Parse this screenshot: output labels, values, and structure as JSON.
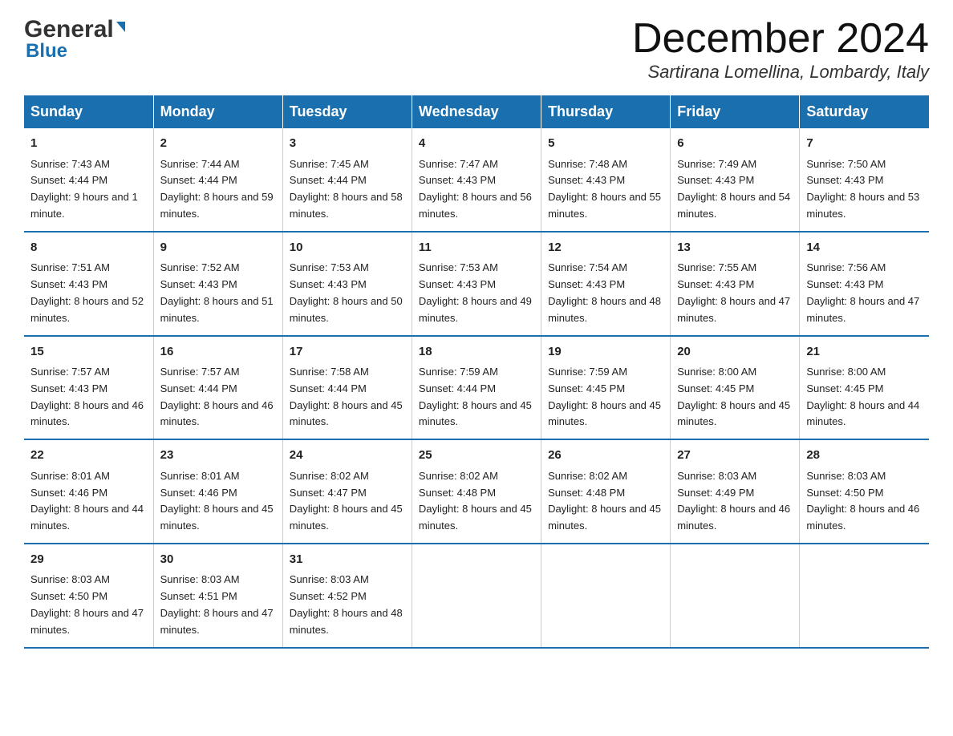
{
  "header": {
    "logo_general": "General",
    "logo_blue": "Blue",
    "month_title": "December 2024",
    "location": "Sartirana Lomellina, Lombardy, Italy"
  },
  "days_of_week": [
    "Sunday",
    "Monday",
    "Tuesday",
    "Wednesday",
    "Thursday",
    "Friday",
    "Saturday"
  ],
  "weeks": [
    [
      {
        "day": "1",
        "sunrise": "7:43 AM",
        "sunset": "4:44 PM",
        "daylight": "9 hours and 1 minute."
      },
      {
        "day": "2",
        "sunrise": "7:44 AM",
        "sunset": "4:44 PM",
        "daylight": "8 hours and 59 minutes."
      },
      {
        "day": "3",
        "sunrise": "7:45 AM",
        "sunset": "4:44 PM",
        "daylight": "8 hours and 58 minutes."
      },
      {
        "day": "4",
        "sunrise": "7:47 AM",
        "sunset": "4:43 PM",
        "daylight": "8 hours and 56 minutes."
      },
      {
        "day": "5",
        "sunrise": "7:48 AM",
        "sunset": "4:43 PM",
        "daylight": "8 hours and 55 minutes."
      },
      {
        "day": "6",
        "sunrise": "7:49 AM",
        "sunset": "4:43 PM",
        "daylight": "8 hours and 54 minutes."
      },
      {
        "day": "7",
        "sunrise": "7:50 AM",
        "sunset": "4:43 PM",
        "daylight": "8 hours and 53 minutes."
      }
    ],
    [
      {
        "day": "8",
        "sunrise": "7:51 AM",
        "sunset": "4:43 PM",
        "daylight": "8 hours and 52 minutes."
      },
      {
        "day": "9",
        "sunrise": "7:52 AM",
        "sunset": "4:43 PM",
        "daylight": "8 hours and 51 minutes."
      },
      {
        "day": "10",
        "sunrise": "7:53 AM",
        "sunset": "4:43 PM",
        "daylight": "8 hours and 50 minutes."
      },
      {
        "day": "11",
        "sunrise": "7:53 AM",
        "sunset": "4:43 PM",
        "daylight": "8 hours and 49 minutes."
      },
      {
        "day": "12",
        "sunrise": "7:54 AM",
        "sunset": "4:43 PM",
        "daylight": "8 hours and 48 minutes."
      },
      {
        "day": "13",
        "sunrise": "7:55 AM",
        "sunset": "4:43 PM",
        "daylight": "8 hours and 47 minutes."
      },
      {
        "day": "14",
        "sunrise": "7:56 AM",
        "sunset": "4:43 PM",
        "daylight": "8 hours and 47 minutes."
      }
    ],
    [
      {
        "day": "15",
        "sunrise": "7:57 AM",
        "sunset": "4:43 PM",
        "daylight": "8 hours and 46 minutes."
      },
      {
        "day": "16",
        "sunrise": "7:57 AM",
        "sunset": "4:44 PM",
        "daylight": "8 hours and 46 minutes."
      },
      {
        "day": "17",
        "sunrise": "7:58 AM",
        "sunset": "4:44 PM",
        "daylight": "8 hours and 45 minutes."
      },
      {
        "day": "18",
        "sunrise": "7:59 AM",
        "sunset": "4:44 PM",
        "daylight": "8 hours and 45 minutes."
      },
      {
        "day": "19",
        "sunrise": "7:59 AM",
        "sunset": "4:45 PM",
        "daylight": "8 hours and 45 minutes."
      },
      {
        "day": "20",
        "sunrise": "8:00 AM",
        "sunset": "4:45 PM",
        "daylight": "8 hours and 45 minutes."
      },
      {
        "day": "21",
        "sunrise": "8:00 AM",
        "sunset": "4:45 PM",
        "daylight": "8 hours and 44 minutes."
      }
    ],
    [
      {
        "day": "22",
        "sunrise": "8:01 AM",
        "sunset": "4:46 PM",
        "daylight": "8 hours and 44 minutes."
      },
      {
        "day": "23",
        "sunrise": "8:01 AM",
        "sunset": "4:46 PM",
        "daylight": "8 hours and 45 minutes."
      },
      {
        "day": "24",
        "sunrise": "8:02 AM",
        "sunset": "4:47 PM",
        "daylight": "8 hours and 45 minutes."
      },
      {
        "day": "25",
        "sunrise": "8:02 AM",
        "sunset": "4:48 PM",
        "daylight": "8 hours and 45 minutes."
      },
      {
        "day": "26",
        "sunrise": "8:02 AM",
        "sunset": "4:48 PM",
        "daylight": "8 hours and 45 minutes."
      },
      {
        "day": "27",
        "sunrise": "8:03 AM",
        "sunset": "4:49 PM",
        "daylight": "8 hours and 46 minutes."
      },
      {
        "day": "28",
        "sunrise": "8:03 AM",
        "sunset": "4:50 PM",
        "daylight": "8 hours and 46 minutes."
      }
    ],
    [
      {
        "day": "29",
        "sunrise": "8:03 AM",
        "sunset": "4:50 PM",
        "daylight": "8 hours and 47 minutes."
      },
      {
        "day": "30",
        "sunrise": "8:03 AM",
        "sunset": "4:51 PM",
        "daylight": "8 hours and 47 minutes."
      },
      {
        "day": "31",
        "sunrise": "8:03 AM",
        "sunset": "4:52 PM",
        "daylight": "8 hours and 48 minutes."
      },
      null,
      null,
      null,
      null
    ]
  ]
}
